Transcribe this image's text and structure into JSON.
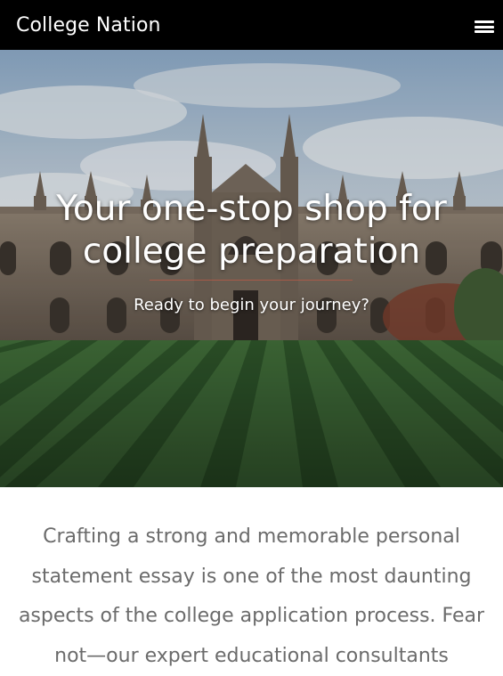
{
  "navbar": {
    "brand": "College Nation",
    "menu_icon": "hamburger-menu-icon"
  },
  "hero": {
    "title_line1": "Your one-stop shop for",
    "title_line2": "college preparation",
    "subtitle": "Ready to begin your journey?",
    "image": "college-campus-photo"
  },
  "intro": {
    "text": "Crafting a strong and memorable personal statement essay is one of the most daunting aspects of the college application process. Fear not—our expert educational consultants"
  }
}
